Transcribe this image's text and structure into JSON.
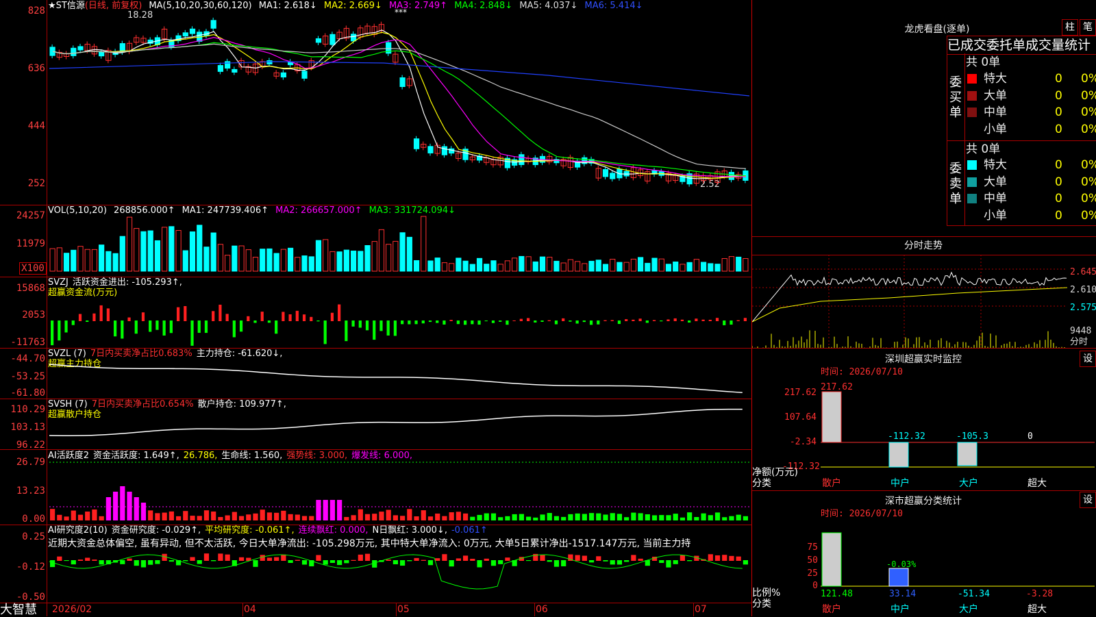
{
  "stock": {
    "name": "★ST信源",
    "period": "(日线, 前复权)",
    "peak": "18.28",
    "low": "2.52",
    "stars": "***"
  },
  "ma": {
    "label": "MA(5,10,20,30,60,120)",
    "ma1": "MA1: 2.618↓",
    "ma2": "MA2: 2.669↓",
    "ma3": "MA3: 2.749↑",
    "ma4": "MA4: 2.848↓",
    "ma5": "MA5: 4.037↓",
    "ma6": "MA6: 5.414↓"
  },
  "price_axis": [
    "828",
    "636",
    "444",
    "252"
  ],
  "vol": {
    "label": "VOL(5,10,20)",
    "value": "268856.000↑",
    "ma1": "MA1: 247739.406↑",
    "ma2": "MA2: 266657.000↑",
    "ma3": "MA3: 331724.094↓",
    "axis": [
      "24257",
      "11979",
      "X100"
    ]
  },
  "svzj": {
    "label": "SVZJ",
    "text1": "活跃资金进出: -105.293↑,",
    "text2": "超赢资金流(万元)",
    "axis": [
      "15868",
      "2053",
      "-11763"
    ]
  },
  "svzl": {
    "label": "SVZL (7)",
    "text1": "7日内买卖净占比0.683%",
    "text2": "主力持仓: -61.620↓,",
    "text3": "超赢主力持仓",
    "axis": [
      "-44.70",
      "-53.25",
      "-61.80"
    ]
  },
  "svsh": {
    "label": "SVSH (7)",
    "text1": "7日内买卖净占比0.654%",
    "text2": "散户持仓: 109.977↑,",
    "text3": "超赢散户持仓",
    "axis": [
      "110.29",
      "103.13",
      "96.22"
    ]
  },
  "ai1": {
    "label": "AI活跃度2",
    "t1": "资金活跃度: 1.649↑,",
    "t2": "26.786,",
    "t3": "生命线: 1.560,",
    "t4": "强势线: 3.000,",
    "t5": "爆发线: 6.000,",
    "axis": [
      "26.79",
      "13.23",
      "0.00"
    ]
  },
  "ai2": {
    "label": "AI研究度2(10)",
    "t1": "资金研究度: -0.029↑,",
    "t2": "平均研究度: -0.061↑,",
    "t3": "连续飘红: 0.000,",
    "t4": "N日飘红: 3.000↓,",
    "t5": "-0.061↑",
    "note": "近期大资金总体偏空, 虽有异动, 但不太活跃, 今日大单净流出: -105.298万元, 其中特大单净流入: 0万元, 大单5日累计净出-1517.147万元, 当前主力持",
    "axis": [
      "0.25",
      "-0.12",
      "-0.50"
    ]
  },
  "dates": [
    "2026/02",
    "04",
    "05",
    "06",
    "07"
  ],
  "brand": "大智慧",
  "dragon": {
    "title": "龙虎看盘(逐单)",
    "btn1": "柱",
    "btn2": "笔",
    "subtitle": "已成交委托单成交量统计",
    "buy_label": "委买单",
    "sell_label": "委卖单",
    "buy_total": "共 0单",
    "sell_total": "共 0单",
    "buy_rows": [
      {
        "name": "特大",
        "n": "0",
        "p": "0%",
        "color": "#ff0000"
      },
      {
        "name": "大单",
        "n": "0",
        "p": "0%",
        "color": "#a01010"
      },
      {
        "name": "中单",
        "n": "0",
        "p": "0%",
        "color": "#801010"
      },
      {
        "name": "小单",
        "n": "0",
        "p": "0%",
        "color": ""
      }
    ],
    "sell_rows": [
      {
        "name": "特大",
        "n": "0",
        "p": "0%",
        "color": "#00ffff"
      },
      {
        "name": "大单",
        "n": "0",
        "p": "0%",
        "color": "#10a0a0"
      },
      {
        "name": "中单",
        "n": "0",
        "p": "0%",
        "color": "#108080"
      },
      {
        "name": "小单",
        "n": "0",
        "p": "0%",
        "color": ""
      }
    ]
  },
  "intraday": {
    "title": "分时走势",
    "axis": [
      "2.645",
      "2.610",
      "2.575"
    ],
    "vol_max": "9448",
    "vol_label": "分时"
  },
  "monitor": {
    "title": "深圳超赢实时监控",
    "btn": "设",
    "time": "时间: 2026/07/10",
    "axis": [
      "217.62",
      "107.64",
      "-2.34",
      "-112.32"
    ],
    "unit": "净额(万元)",
    "cat_label": "分类",
    "cats": [
      "散户",
      "中户",
      "大户",
      "超大"
    ],
    "values": [
      "217.62",
      "-112.32",
      "-105.3",
      "0"
    ]
  },
  "classify": {
    "title": "深市超赢分类统计",
    "btn": "设",
    "time": "时间: 2026/07/10",
    "axis": [
      "75",
      "50",
      "25",
      "0"
    ],
    "ratio_label": "比例%",
    "cat_label": "分类",
    "cats": [
      "散户",
      "中户",
      "大户",
      "超大"
    ],
    "values": [
      "121.48",
      "33.14",
      "-51.34",
      "-3.28"
    ],
    "mid_label": "-0.03%"
  }
}
